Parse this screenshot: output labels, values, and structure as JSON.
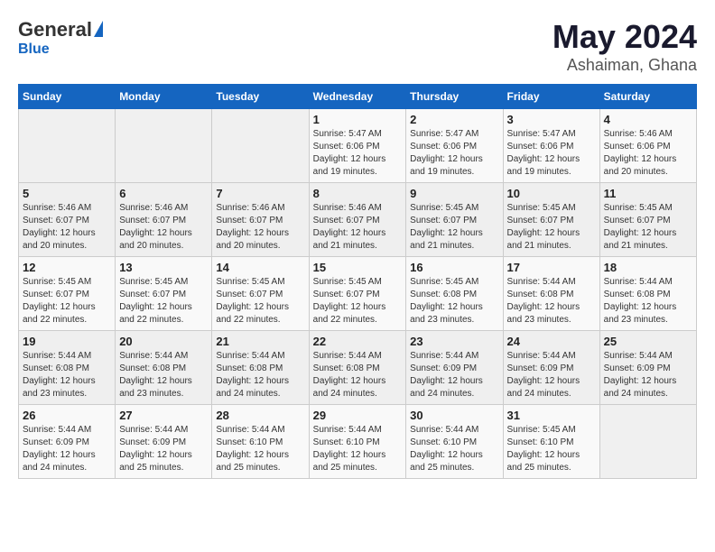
{
  "logo": {
    "general": "General",
    "blue": "Blue"
  },
  "title": "May 2024",
  "subtitle": "Ashaiman, Ghana",
  "weekdays": [
    "Sunday",
    "Monday",
    "Tuesday",
    "Wednesday",
    "Thursday",
    "Friday",
    "Saturday"
  ],
  "weeks": [
    [
      {
        "day": "",
        "info": ""
      },
      {
        "day": "",
        "info": ""
      },
      {
        "day": "",
        "info": ""
      },
      {
        "day": "1",
        "info": "Sunrise: 5:47 AM\nSunset: 6:06 PM\nDaylight: 12 hours\nand 19 minutes."
      },
      {
        "day": "2",
        "info": "Sunrise: 5:47 AM\nSunset: 6:06 PM\nDaylight: 12 hours\nand 19 minutes."
      },
      {
        "day": "3",
        "info": "Sunrise: 5:47 AM\nSunset: 6:06 PM\nDaylight: 12 hours\nand 19 minutes."
      },
      {
        "day": "4",
        "info": "Sunrise: 5:46 AM\nSunset: 6:06 PM\nDaylight: 12 hours\nand 20 minutes."
      }
    ],
    [
      {
        "day": "5",
        "info": "Sunrise: 5:46 AM\nSunset: 6:07 PM\nDaylight: 12 hours\nand 20 minutes."
      },
      {
        "day": "6",
        "info": "Sunrise: 5:46 AM\nSunset: 6:07 PM\nDaylight: 12 hours\nand 20 minutes."
      },
      {
        "day": "7",
        "info": "Sunrise: 5:46 AM\nSunset: 6:07 PM\nDaylight: 12 hours\nand 20 minutes."
      },
      {
        "day": "8",
        "info": "Sunrise: 5:46 AM\nSunset: 6:07 PM\nDaylight: 12 hours\nand 21 minutes."
      },
      {
        "day": "9",
        "info": "Sunrise: 5:45 AM\nSunset: 6:07 PM\nDaylight: 12 hours\nand 21 minutes."
      },
      {
        "day": "10",
        "info": "Sunrise: 5:45 AM\nSunset: 6:07 PM\nDaylight: 12 hours\nand 21 minutes."
      },
      {
        "day": "11",
        "info": "Sunrise: 5:45 AM\nSunset: 6:07 PM\nDaylight: 12 hours\nand 21 minutes."
      }
    ],
    [
      {
        "day": "12",
        "info": "Sunrise: 5:45 AM\nSunset: 6:07 PM\nDaylight: 12 hours\nand 22 minutes."
      },
      {
        "day": "13",
        "info": "Sunrise: 5:45 AM\nSunset: 6:07 PM\nDaylight: 12 hours\nand 22 minutes."
      },
      {
        "day": "14",
        "info": "Sunrise: 5:45 AM\nSunset: 6:07 PM\nDaylight: 12 hours\nand 22 minutes."
      },
      {
        "day": "15",
        "info": "Sunrise: 5:45 AM\nSunset: 6:07 PM\nDaylight: 12 hours\nand 22 minutes."
      },
      {
        "day": "16",
        "info": "Sunrise: 5:45 AM\nSunset: 6:08 PM\nDaylight: 12 hours\nand 23 minutes."
      },
      {
        "day": "17",
        "info": "Sunrise: 5:44 AM\nSunset: 6:08 PM\nDaylight: 12 hours\nand 23 minutes."
      },
      {
        "day": "18",
        "info": "Sunrise: 5:44 AM\nSunset: 6:08 PM\nDaylight: 12 hours\nand 23 minutes."
      }
    ],
    [
      {
        "day": "19",
        "info": "Sunrise: 5:44 AM\nSunset: 6:08 PM\nDaylight: 12 hours\nand 23 minutes."
      },
      {
        "day": "20",
        "info": "Sunrise: 5:44 AM\nSunset: 6:08 PM\nDaylight: 12 hours\nand 23 minutes."
      },
      {
        "day": "21",
        "info": "Sunrise: 5:44 AM\nSunset: 6:08 PM\nDaylight: 12 hours\nand 24 minutes."
      },
      {
        "day": "22",
        "info": "Sunrise: 5:44 AM\nSunset: 6:08 PM\nDaylight: 12 hours\nand 24 minutes."
      },
      {
        "day": "23",
        "info": "Sunrise: 5:44 AM\nSunset: 6:09 PM\nDaylight: 12 hours\nand 24 minutes."
      },
      {
        "day": "24",
        "info": "Sunrise: 5:44 AM\nSunset: 6:09 PM\nDaylight: 12 hours\nand 24 minutes."
      },
      {
        "day": "25",
        "info": "Sunrise: 5:44 AM\nSunset: 6:09 PM\nDaylight: 12 hours\nand 24 minutes."
      }
    ],
    [
      {
        "day": "26",
        "info": "Sunrise: 5:44 AM\nSunset: 6:09 PM\nDaylight: 12 hours\nand 24 minutes."
      },
      {
        "day": "27",
        "info": "Sunrise: 5:44 AM\nSunset: 6:09 PM\nDaylight: 12 hours\nand 25 minutes."
      },
      {
        "day": "28",
        "info": "Sunrise: 5:44 AM\nSunset: 6:10 PM\nDaylight: 12 hours\nand 25 minutes."
      },
      {
        "day": "29",
        "info": "Sunrise: 5:44 AM\nSunset: 6:10 PM\nDaylight: 12 hours\nand 25 minutes."
      },
      {
        "day": "30",
        "info": "Sunrise: 5:44 AM\nSunset: 6:10 PM\nDaylight: 12 hours\nand 25 minutes."
      },
      {
        "day": "31",
        "info": "Sunrise: 5:45 AM\nSunset: 6:10 PM\nDaylight: 12 hours\nand 25 minutes."
      },
      {
        "day": "",
        "info": ""
      }
    ]
  ]
}
